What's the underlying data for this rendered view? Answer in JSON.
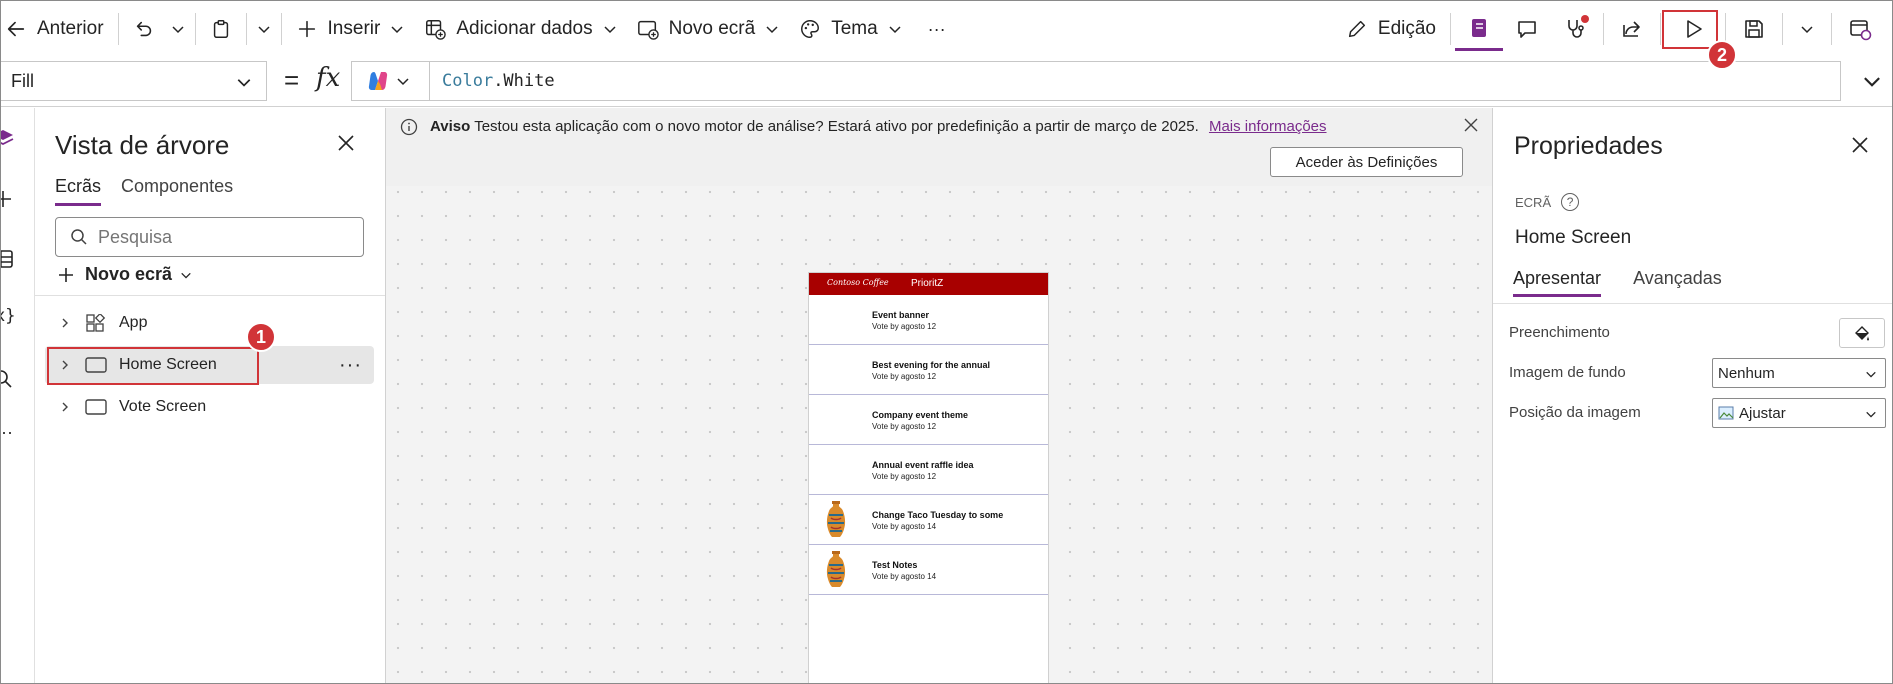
{
  "toolbar": {
    "back_label": "Anterior",
    "insert_label": "Inserir",
    "add_data_label": "Adicionar dados",
    "new_screen_label": "Novo ecrã",
    "theme_label": "Tema",
    "more_label": "···",
    "edit_label": "Edição"
  },
  "formula_bar": {
    "property": "Fill",
    "equals": "=",
    "fx": "fx",
    "formula_object": "Color",
    "formula_member": ".White"
  },
  "tree_view": {
    "title": "Vista de árvore",
    "tabs": [
      "Ecrãs",
      "Componentes"
    ],
    "search_placeholder": "Pesquisa",
    "new_screen_label": "Novo ecrã",
    "items": [
      {
        "label": "App"
      },
      {
        "label": "Home Screen"
      },
      {
        "label": "Vote Screen"
      }
    ]
  },
  "notice": {
    "bold": "Aviso",
    "text": "Testou esta aplicação com o novo motor de análise? Estará ativo por predefinição a partir de março de 2025.",
    "link": "Mais informações",
    "button": "Aceder às Definições"
  },
  "phone": {
    "logo": "Contoso Coffee",
    "title": "PrioritZ",
    "items": [
      {
        "title": "Event banner",
        "subtitle": "Vote by agosto 12",
        "has_image": false
      },
      {
        "title": "Best evening for the annual",
        "subtitle": "Vote by agosto 12",
        "has_image": false
      },
      {
        "title": "Company event theme",
        "subtitle": "Vote by agosto 12",
        "has_image": false
      },
      {
        "title": "Annual event raffle idea",
        "subtitle": "Vote by agosto 12",
        "has_image": false
      },
      {
        "title": "Change Taco Tuesday to some",
        "subtitle": "Vote by agosto 14",
        "has_image": true
      },
      {
        "title": "Test Notes",
        "subtitle": "Vote by agosto 14",
        "has_image": true
      }
    ]
  },
  "properties": {
    "title": "Propriedades",
    "kind": "ECRÃ",
    "name": "Home Screen",
    "tabs": [
      "Apresentar",
      "Avançadas"
    ],
    "rows": [
      {
        "label": "Preenchimento"
      },
      {
        "label": "Imagem de fundo",
        "value": "Nenhum"
      },
      {
        "label": "Posição da imagem",
        "value": "Ajustar"
      }
    ]
  },
  "annotations": {
    "badge_1": "1",
    "badge_2": "2",
    "color": "#d13438"
  },
  "colors": {
    "accent": "#7a2b8c",
    "header_red": "#a80000"
  }
}
